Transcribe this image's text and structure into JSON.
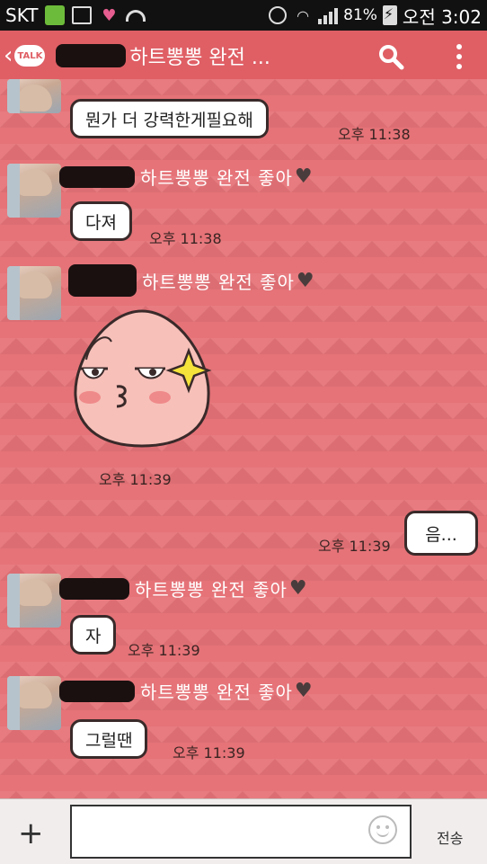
{
  "status_bar": {
    "carrier": "SKT",
    "battery": "81%",
    "time": "오전 3:02"
  },
  "header": {
    "back_symbol": "‹",
    "app_badge": "TALK",
    "chat_title": "하트뽕뽕 완전 ..."
  },
  "messages": [
    {
      "id": "m1",
      "type": "incoming-continuation",
      "text": "뭔가 더 강력한게필요해",
      "time": "오후 11:38"
    },
    {
      "id": "m2",
      "type": "incoming",
      "sender": "하트뽕뽕 완전 좋아",
      "text": "다져",
      "time": "오후 11:38"
    },
    {
      "id": "m3",
      "type": "incoming-emoticon",
      "sender": "하트뽕뽕 완전 좋아",
      "time": "오후 11:39"
    },
    {
      "id": "m4",
      "type": "outgoing",
      "text": "음...",
      "time": "오후 11:39"
    },
    {
      "id": "m5",
      "type": "incoming",
      "sender": "하트뽕뽕 완전 좋아",
      "text": "자",
      "time": "오후 11:39"
    },
    {
      "id": "m6",
      "type": "incoming",
      "sender": "하트뽕뽕 완전 좋아",
      "text": "그럴땐",
      "time": "오후 11:39"
    }
  ],
  "input_bar": {
    "plus_symbol": "+",
    "input_value": "",
    "input_placeholder": "",
    "send_label": "전송"
  },
  "colors": {
    "chat_background": "#e57378",
    "header_background": "#df5f65",
    "bubble_border": "#3a2a2a",
    "sender_name": "#ffffff"
  }
}
